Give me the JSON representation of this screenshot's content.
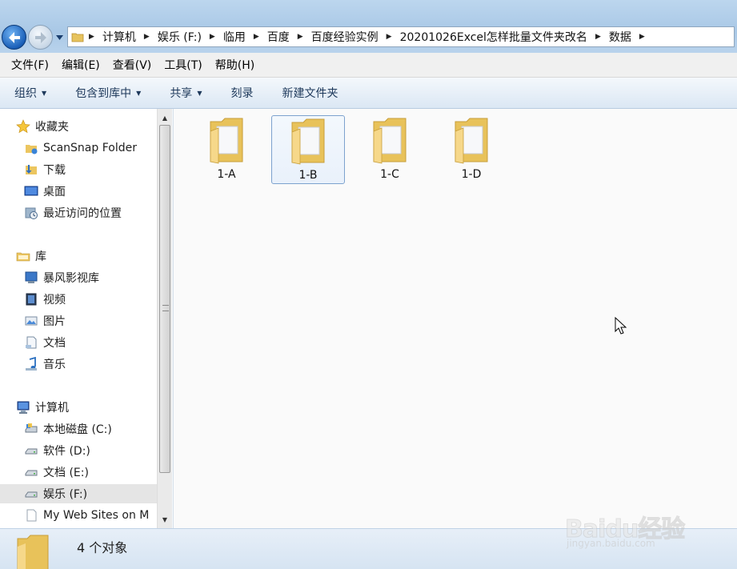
{
  "address_bar": {
    "crumbs": [
      "计算机",
      "娱乐 (F:)",
      "临用",
      "百度",
      "百度经验实例",
      "20201026Excel怎样批量文件夹改名",
      "数据"
    ]
  },
  "menu": {
    "items": [
      "文件(F)",
      "编辑(E)",
      "查看(V)",
      "工具(T)",
      "帮助(H)"
    ]
  },
  "toolbar": {
    "organize": "组织",
    "include_in_library": "包含到库中",
    "share": "共享",
    "burn": "刻录",
    "new_folder": "新建文件夹"
  },
  "sidebar": {
    "favorites_header": "收藏夹",
    "favorites": [
      "ScanSnap Folder",
      "下载",
      "桌面",
      "最近访问的位置"
    ],
    "libraries_header": "库",
    "libraries": [
      "暴风影视库",
      "视频",
      "图片",
      "文档",
      "音乐"
    ],
    "computer_header": "计算机",
    "drives": [
      "本地磁盘 (C:)",
      "软件 (D:)",
      "文档 (E:)",
      "娱乐 (F:)",
      "My Web Sites on M"
    ],
    "selected": "娱乐 (F:)"
  },
  "content": {
    "folders": [
      "1-A",
      "1-B",
      "1-C",
      "1-D"
    ],
    "selected_folder": "1-B"
  },
  "status": {
    "count_text": "4 个对象"
  },
  "watermark": {
    "brand": "Baidu经验",
    "url": "jingyan.baidu.com"
  },
  "colors": {
    "folder_yellow": "#f3d57a",
    "selection_border": "#7da2ce",
    "command_text": "#1e395b"
  }
}
